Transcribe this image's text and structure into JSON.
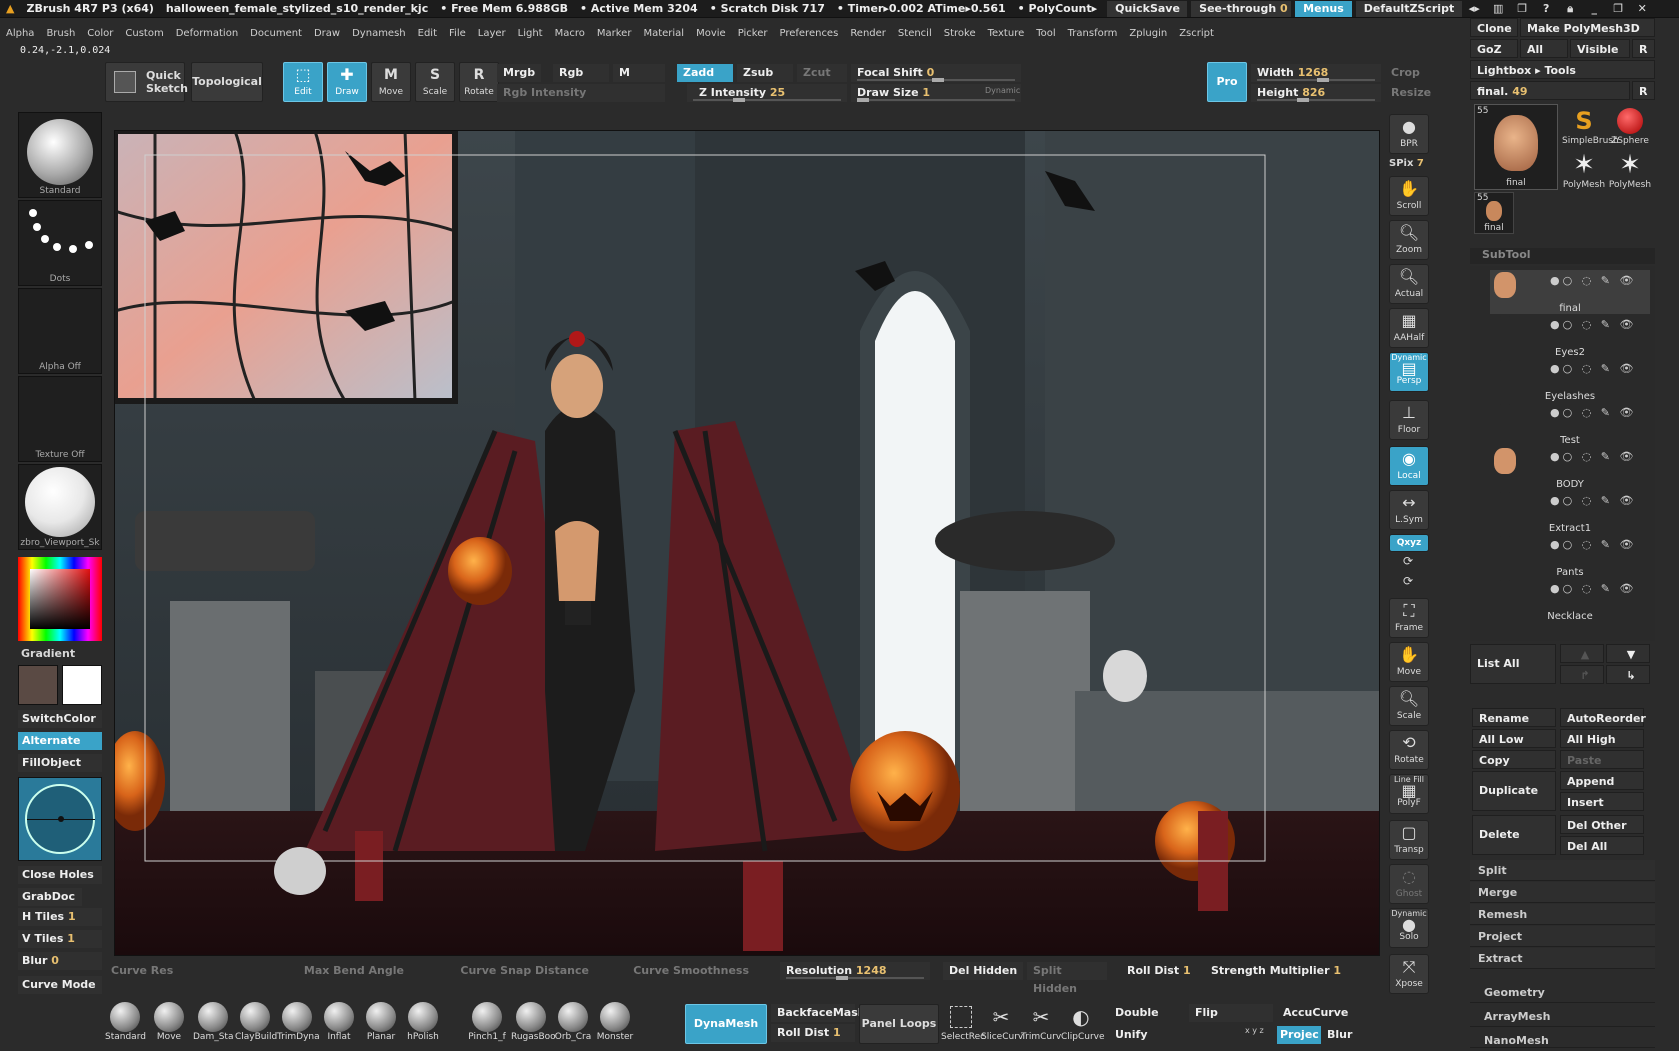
{
  "titlebar": {
    "app": "ZBrush 4R7 P3 (x64)",
    "file": "halloween_female_stylized_s10_render_kjc",
    "free_mem": "• Free Mem 6.988GB",
    "active_mem": "• Active Mem 3204",
    "scratch": "• Scratch Disk 717",
    "timer": "• Timer▸0.002 ATime▸0.561",
    "polycount": "• PolyCount▸",
    "quicksave": "QuickSave",
    "seethrough": "See-through",
    "seethrough_val": "0",
    "menus": "Menus",
    "script": "DefaultZScript"
  },
  "menu": [
    "Alpha",
    "Brush",
    "Color",
    "Custom",
    "Deformation",
    "Document",
    "Draw",
    "Dynamesh",
    "Edit",
    "File",
    "Layer",
    "Light",
    "Macro",
    "Marker",
    "Material",
    "Movie",
    "Picker",
    "Preferences",
    "Render",
    "Stencil",
    "Stroke",
    "Texture",
    "Tool",
    "Transform",
    "Zplugin",
    "Zscript"
  ],
  "coords": "0.24,-2.1,0.024",
  "toolbar": {
    "quick_sketch": "Quick Sketch",
    "topological": "Topological",
    "edit": "Edit",
    "draw": "Draw",
    "move": "Move",
    "scale": "Scale",
    "rotate": "Rotate",
    "mrgb": "Mrgb",
    "rgb": "Rgb",
    "m": "M",
    "rgb_intensity": "Rgb Intensity",
    "zadd": "Zadd",
    "zsub": "Zsub",
    "zcut": "Zcut",
    "z_intensity_label": "Z Intensity",
    "z_intensity": "25",
    "focal_shift_label": "Focal Shift",
    "focal_shift": "0",
    "draw_size_label": "Draw Size",
    "draw_size": "1",
    "dynamic": "Dynamic",
    "pro": "Pro",
    "width_label": "Width",
    "width": "1268",
    "height_label": "Height",
    "height": "826",
    "crop": "Crop",
    "resize": "Resize"
  },
  "left": {
    "standard": "Standard",
    "dots": "Dots",
    "alpha_off": "Alpha  Off",
    "texture_off": "Texture  Off",
    "material": "zbro_Viewport_Sk",
    "gradient": "Gradient",
    "switchcolor": "SwitchColor",
    "alternate": "Alternate",
    "fillobject": "FillObject",
    "close_holes": "Close Holes",
    "grabdoc": "GrabDoc",
    "h_tiles_label": "H Tiles",
    "h_tiles": "1",
    "v_tiles_label": "V Tiles",
    "v_tiles": "1",
    "blur_label": "Blur",
    "blur": "0",
    "curve_mode": "Curve Mode",
    "main_color": "#5a4a44",
    "secondary_color": "#ffffff"
  },
  "right_tray": {
    "bpr": "BPR",
    "spix_label": "SPix",
    "spix": "7",
    "scroll": "Scroll",
    "zoom": "Zoom",
    "actual": "Actual",
    "aahalf": "AAHalf",
    "dynamic": "Dynamic",
    "persp": "Persp",
    "floor": "Floor",
    "local": "Local",
    "lsym": "L.Sym",
    "xyz": "Qxyz",
    "frame": "Frame",
    "move": "Move",
    "scale": "Scale",
    "rotate": "Rotate",
    "linefill": "Line Fill",
    "polyf": "PolyF",
    "transp": "Transp",
    "ghost": "Ghost",
    "dynamic2": "Dynamic",
    "solo": "Solo",
    "xpose": "Xpose"
  },
  "panel": {
    "clone": "Clone",
    "make_polymesh": "Make PolyMesh3D",
    "goz": "GoZ",
    "all": "All",
    "visible": "Visible",
    "r": "R",
    "lightbox_tools": "Lightbox ▸ Tools",
    "final_label": "final.",
    "final_val": "49",
    "thumb_count": "55",
    "tools": [
      {
        "name": "final"
      },
      {
        "name": "SimpleBrush"
      },
      {
        "name": "ZSphere"
      },
      {
        "name": "PolyMesh"
      },
      {
        "name": "PolyMesh"
      }
    ],
    "small_thumb": {
      "count": "55",
      "name": "final"
    },
    "subtool_title": "SubTool",
    "subtools": [
      "final",
      "Eyes2",
      "Eyelashes",
      "Test",
      "BODY",
      "Extract1",
      "Pants",
      "Necklace"
    ],
    "list_all": "List  All",
    "rename": "Rename",
    "autoreorder": "AutoReorder",
    "all_low": "All  Low",
    "all_high": "All  High",
    "copy": "Copy",
    "paste": "Paste",
    "duplicate": "Duplicate",
    "append": "Append",
    "insert": "Insert",
    "delete": "Delete",
    "del_other": "Del  Other",
    "del_all": "Del  All",
    "split": "Split",
    "merge": "Merge",
    "remesh": "Remesh",
    "project": "Project",
    "extract": "Extract",
    "geometry": "Geometry",
    "arraymesh": "ArrayMesh",
    "nanomesh": "NanoMesh"
  },
  "bottom": {
    "curve_res": "Curve Res",
    "max_bend": "Max Bend Angle",
    "curve_snap": "Curve Snap Distance",
    "curve_smooth": "Curve Smoothness",
    "resolution_label": "Resolution",
    "resolution": "1248",
    "del_hidden": "Del Hidden",
    "split_hidden": "Split Hidden",
    "roll_dist_label": "Roll Dist",
    "roll_dist": "1",
    "strength_label": "Strength Multiplier",
    "strength": "1",
    "brushes": [
      "Standard",
      "Move",
      "Dam_Sta",
      "ClayBuild",
      "TrimDyna",
      "Inflat",
      "Planar",
      "hPolish",
      "Pinch1_f",
      "RugasBoo",
      "Orb_Cra",
      "Monster"
    ],
    "dynamesh": "DynaMesh",
    "backface": "BackfaceMask",
    "rolldist2_label": "Roll Dist",
    "rolldist2": "1",
    "panel_loops": "Panel Loops",
    "selectrect": "SelectRec",
    "slicecurve": "SliceCurv",
    "trimcurve": "TrimCurv",
    "clipcurve": "ClipCurve",
    "double": "Double",
    "flip": "Flip",
    "unify": "Unify",
    "xyz": "x y z",
    "accucurve": "AccuCurve",
    "project": "Projec",
    "blur": "Blur"
  }
}
